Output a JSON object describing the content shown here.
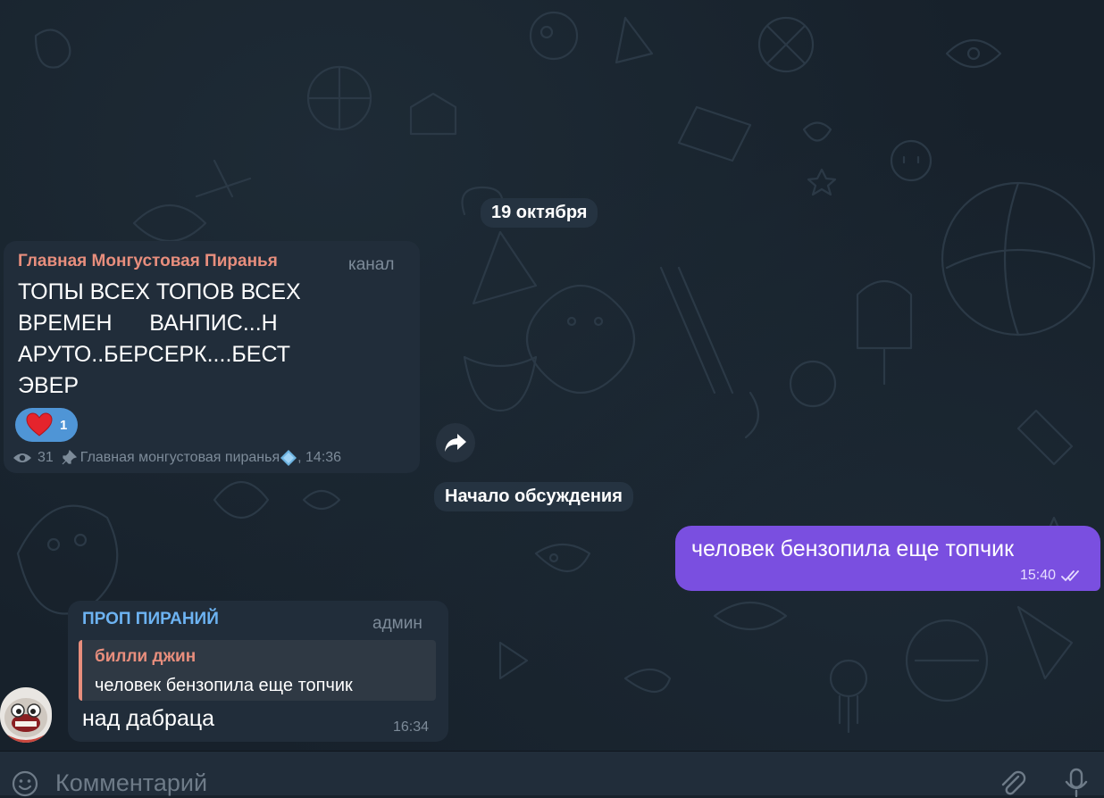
{
  "dates": {
    "day": "19 октября",
    "discussion_start": "Начало обсуждения"
  },
  "channel_post": {
    "sender": "Главная Монгустовая Пиранья",
    "role": "канал",
    "text_lines": [
      "ТОПЫ ВСЕХ ТОПОВ ВСЕХ",
      "ВРЕМЕН      ВАНПИС...Н",
      "АРУТО..БЕРСЕРК....БЕСТ",
      "ЭВЕР"
    ],
    "reaction_count": "1",
    "views": "31",
    "signature": "Главная монгустовая пиранья",
    "time_suffix": ", 14:36",
    "sender_color": "#e88e7d"
  },
  "outgoing": {
    "text": "человек бензопила еще топчик",
    "time": "15:40",
    "bubble_color": "#7a4fe0"
  },
  "reply_message": {
    "sender": "ПРОП ПИРАНИЙ",
    "role": "админ",
    "quote_author": "билли джин",
    "quote_text": "человек бензопила еще топчик",
    "text": "над дабраца",
    "time": "16:34",
    "sender_color": "#6db3f2"
  },
  "composer": {
    "placeholder": "Комментарий"
  },
  "icons": [
    "heart-icon",
    "eye-icon",
    "pin-icon",
    "diamond-icon",
    "forward-icon",
    "read-checkmarks-icon",
    "emoji-icon",
    "attach-icon",
    "microphone-icon"
  ]
}
